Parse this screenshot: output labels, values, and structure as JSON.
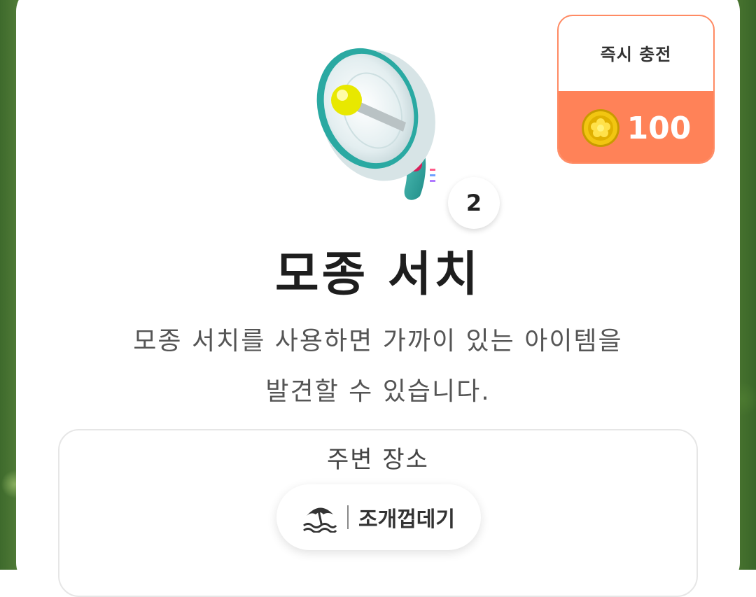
{
  "item": {
    "count": "2",
    "name": "모종 서치",
    "description_line1": "모종 서치를 사용하면 가까이 있는 아이템을",
    "description_line2": "발견할 수 있습니다."
  },
  "charge": {
    "title": "즉시 충전",
    "amount": "100",
    "icon": "gold-coin-icon",
    "accent_color": "#ff8258"
  },
  "nearby": {
    "title": "주변 장소",
    "place_label": "조개껍데기",
    "place_icon": "beach-umbrella-icon"
  }
}
